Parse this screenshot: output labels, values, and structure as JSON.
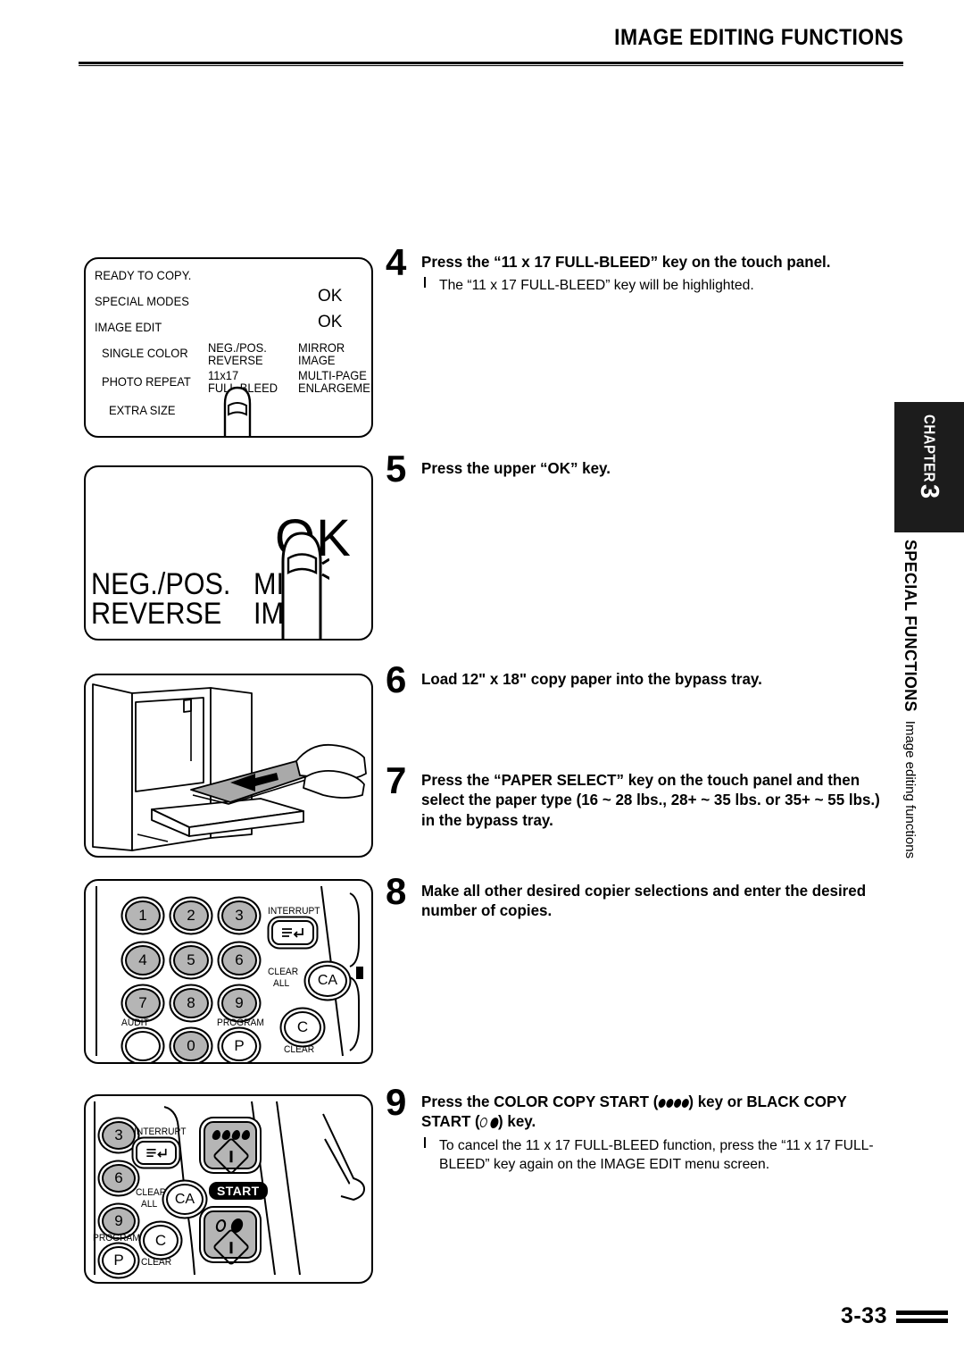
{
  "header": {
    "title": "IMAGE EDITING FUNCTIONS"
  },
  "footer": {
    "page_number": "3-33"
  },
  "side_tab": {
    "chapter_word": "CHAPTER",
    "chapter_number": "3",
    "section_bold": "SPECIAL FUNCTIONS",
    "section_regular": "Image editing functions"
  },
  "steps": [
    {
      "number": "4",
      "title": "Press the “11 x 17 FULL-BLEED” key on the touch panel.",
      "sub": "The “11 x 17 FULL-BLEED” key will be highlighted."
    },
    {
      "number": "5",
      "title": "Press the upper “OK” key.",
      "sub": ""
    },
    {
      "number": "6",
      "title": "Load 12\" x 18\" copy paper into the bypass tray.",
      "sub": ""
    },
    {
      "number": "7",
      "title": "Press the “PAPER SELECT” key on the touch panel and then select the paper type (16 ~ 28 lbs., 28+ ~ 35 lbs. or 35+ ~ 55 lbs.) in the bypass tray.",
      "sub": ""
    },
    {
      "number": "8",
      "title": "Make all other desired copier selections and enter the desired number of copies.",
      "sub": ""
    },
    {
      "number": "9",
      "title_part1": "Press the COLOR COPY START (",
      "title_part2": ") key or BLACK COPY START (",
      "title_part3": ") key.",
      "number_label": "9",
      "sub": "To cancel the 11 x 17 FULL-BLEED function, press the “11 x 17 FULL-BLEED” key again on the IMAGE EDIT menu screen."
    }
  ],
  "touch_panel": {
    "status": "READY TO COPY.",
    "rows": [
      {
        "label": "SPECIAL MODES",
        "action": "OK"
      },
      {
        "label": "IMAGE EDIT",
        "action": "OK"
      }
    ],
    "buttons": [
      "SINGLE COLOR",
      "NEG./POS. REVERSE",
      "MIRROR IMAGE",
      "PHOTO REPEAT",
      "11x17 FULL-BLEED",
      "MULTI-PAGE ENLARGEMENT",
      "EXTRA SIZE"
    ],
    "button_lines": {
      "single_color": "SINGLE COLOR",
      "negpos_l1": "NEG./POS.",
      "negpos_l2": "REVERSE",
      "mirror_l1": "MIRROR",
      "mirror_l2": "IMAGE",
      "photo_repeat": "PHOTO REPEAT",
      "fullbleed_l1": "11x17",
      "fullbleed_l2": "FULL-BLEED",
      "multipage_l1": "MULTI-PAGE",
      "multipage_l2": "ENLARGEMENT",
      "extra_size": "EXTRA SIZE"
    }
  },
  "zoom_panel": {
    "ok": "OK",
    "left_l1": "NEG./POS.",
    "left_l2": "REVERSE",
    "right_l1": "MIR",
    "right_l2": "IMA"
  },
  "keypad": {
    "digits": [
      "1",
      "2",
      "3",
      "4",
      "5",
      "6",
      "7",
      "8",
      "9",
      "0"
    ],
    "program_key": "P",
    "clear_key": "C",
    "clear_all_key": "CA",
    "labels": {
      "interrupt": "INTERRUPT",
      "clear_all_l1": "CLEAR",
      "clear_all_l2": "ALL",
      "clear": "CLEAR",
      "audit": "AUDIT",
      "program": "PROGRAM"
    }
  },
  "start_panel": {
    "digits": [
      "3",
      "6",
      "9"
    ],
    "program_key": "P",
    "clear_key": "C",
    "clear_all_key": "CA",
    "start_badge": "START",
    "labels": {
      "interrupt": "INTERRUPT",
      "clear_all_l1": "CLEAR",
      "clear_all_l2": "ALL",
      "clear": "CLEAR",
      "program": "PROGRAM"
    }
  },
  "colors": {
    "key_gray": "#b5b5b5",
    "paper_gray": "#a9a9a9",
    "tab_black": "#1c1c1c"
  }
}
